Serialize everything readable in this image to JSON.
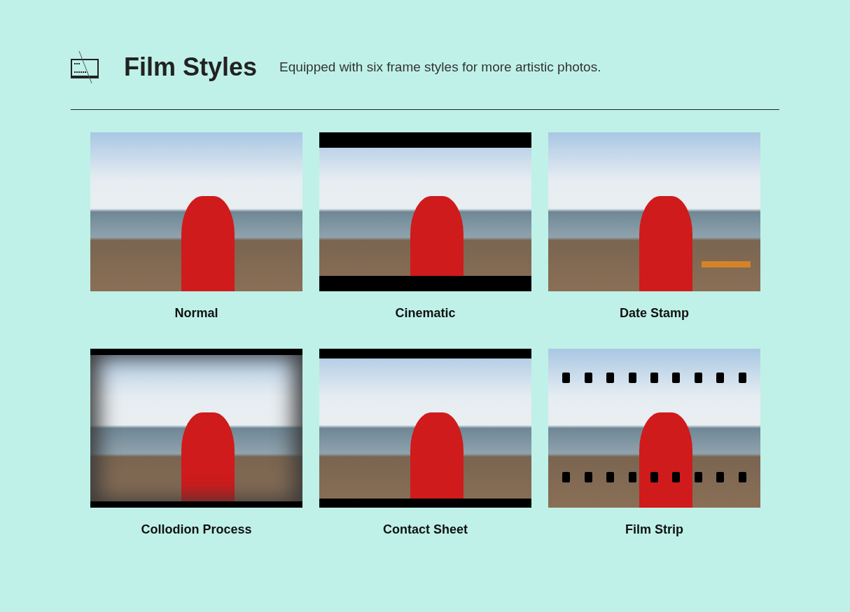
{
  "header": {
    "title": "Film Styles",
    "subtitle": "Equipped with six frame styles for more artistic photos."
  },
  "styles": [
    {
      "label": "Normal",
      "kind": "normal"
    },
    {
      "label": "Cinematic",
      "kind": "cinematic"
    },
    {
      "label": "Date Stamp",
      "kind": "datestamp"
    },
    {
      "label": "Collodion Process",
      "kind": "collodion"
    },
    {
      "label": "Contact Sheet",
      "kind": "contact"
    },
    {
      "label": "Film Strip",
      "kind": "filmstrip"
    }
  ]
}
